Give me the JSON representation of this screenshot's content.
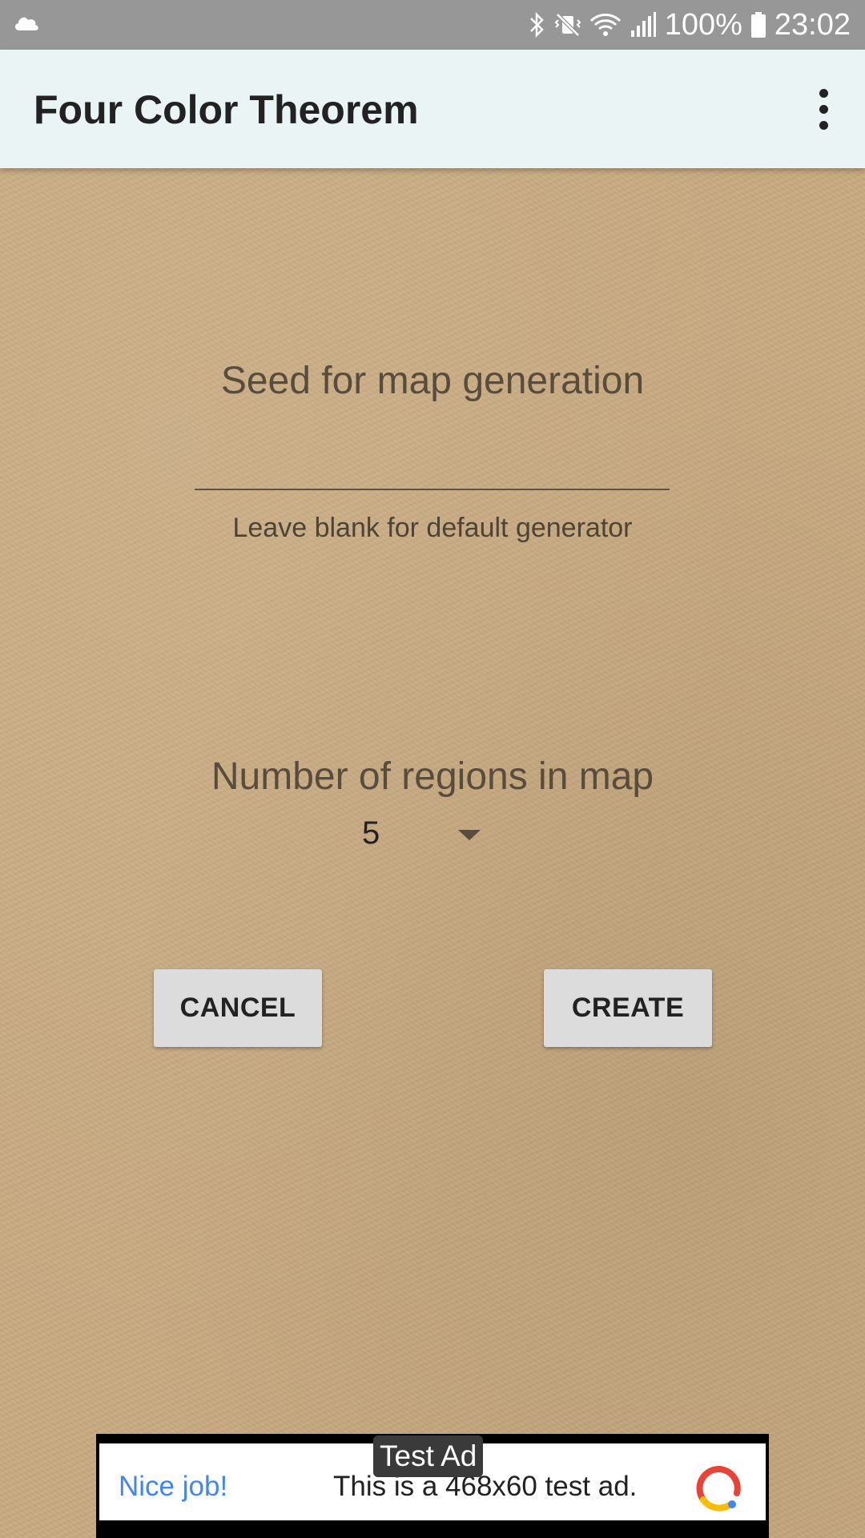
{
  "status_bar": {
    "battery": "100%",
    "time": "23:02",
    "icons": [
      "cloud-icon",
      "bluetooth-icon",
      "mute-vibrate-icon",
      "wifi-icon",
      "signal-icon",
      "battery-icon"
    ]
  },
  "app_bar": {
    "title": "Four Color Theorem",
    "menu_icon": "more-vert-icon"
  },
  "form": {
    "seed_label": "Seed for map generation",
    "seed_value": "",
    "seed_hint": "Leave blank for default generator",
    "regions_label": "Number of regions in map",
    "regions_value": "5",
    "cancel_label": "CANCEL",
    "create_label": "CREATE"
  },
  "ad": {
    "badge": "Test Ad",
    "headline": "Nice job!",
    "text": "This is a 468x60 test ad.",
    "logo_icon": "ad-network-logo-icon"
  },
  "colors": {
    "status_bar_bg": "#979797",
    "app_bar_bg": "#eaf4f4",
    "paper_bg": "#c8aa80",
    "button_bg": "#dcdcdc",
    "ad_headline": "#4285f4"
  }
}
